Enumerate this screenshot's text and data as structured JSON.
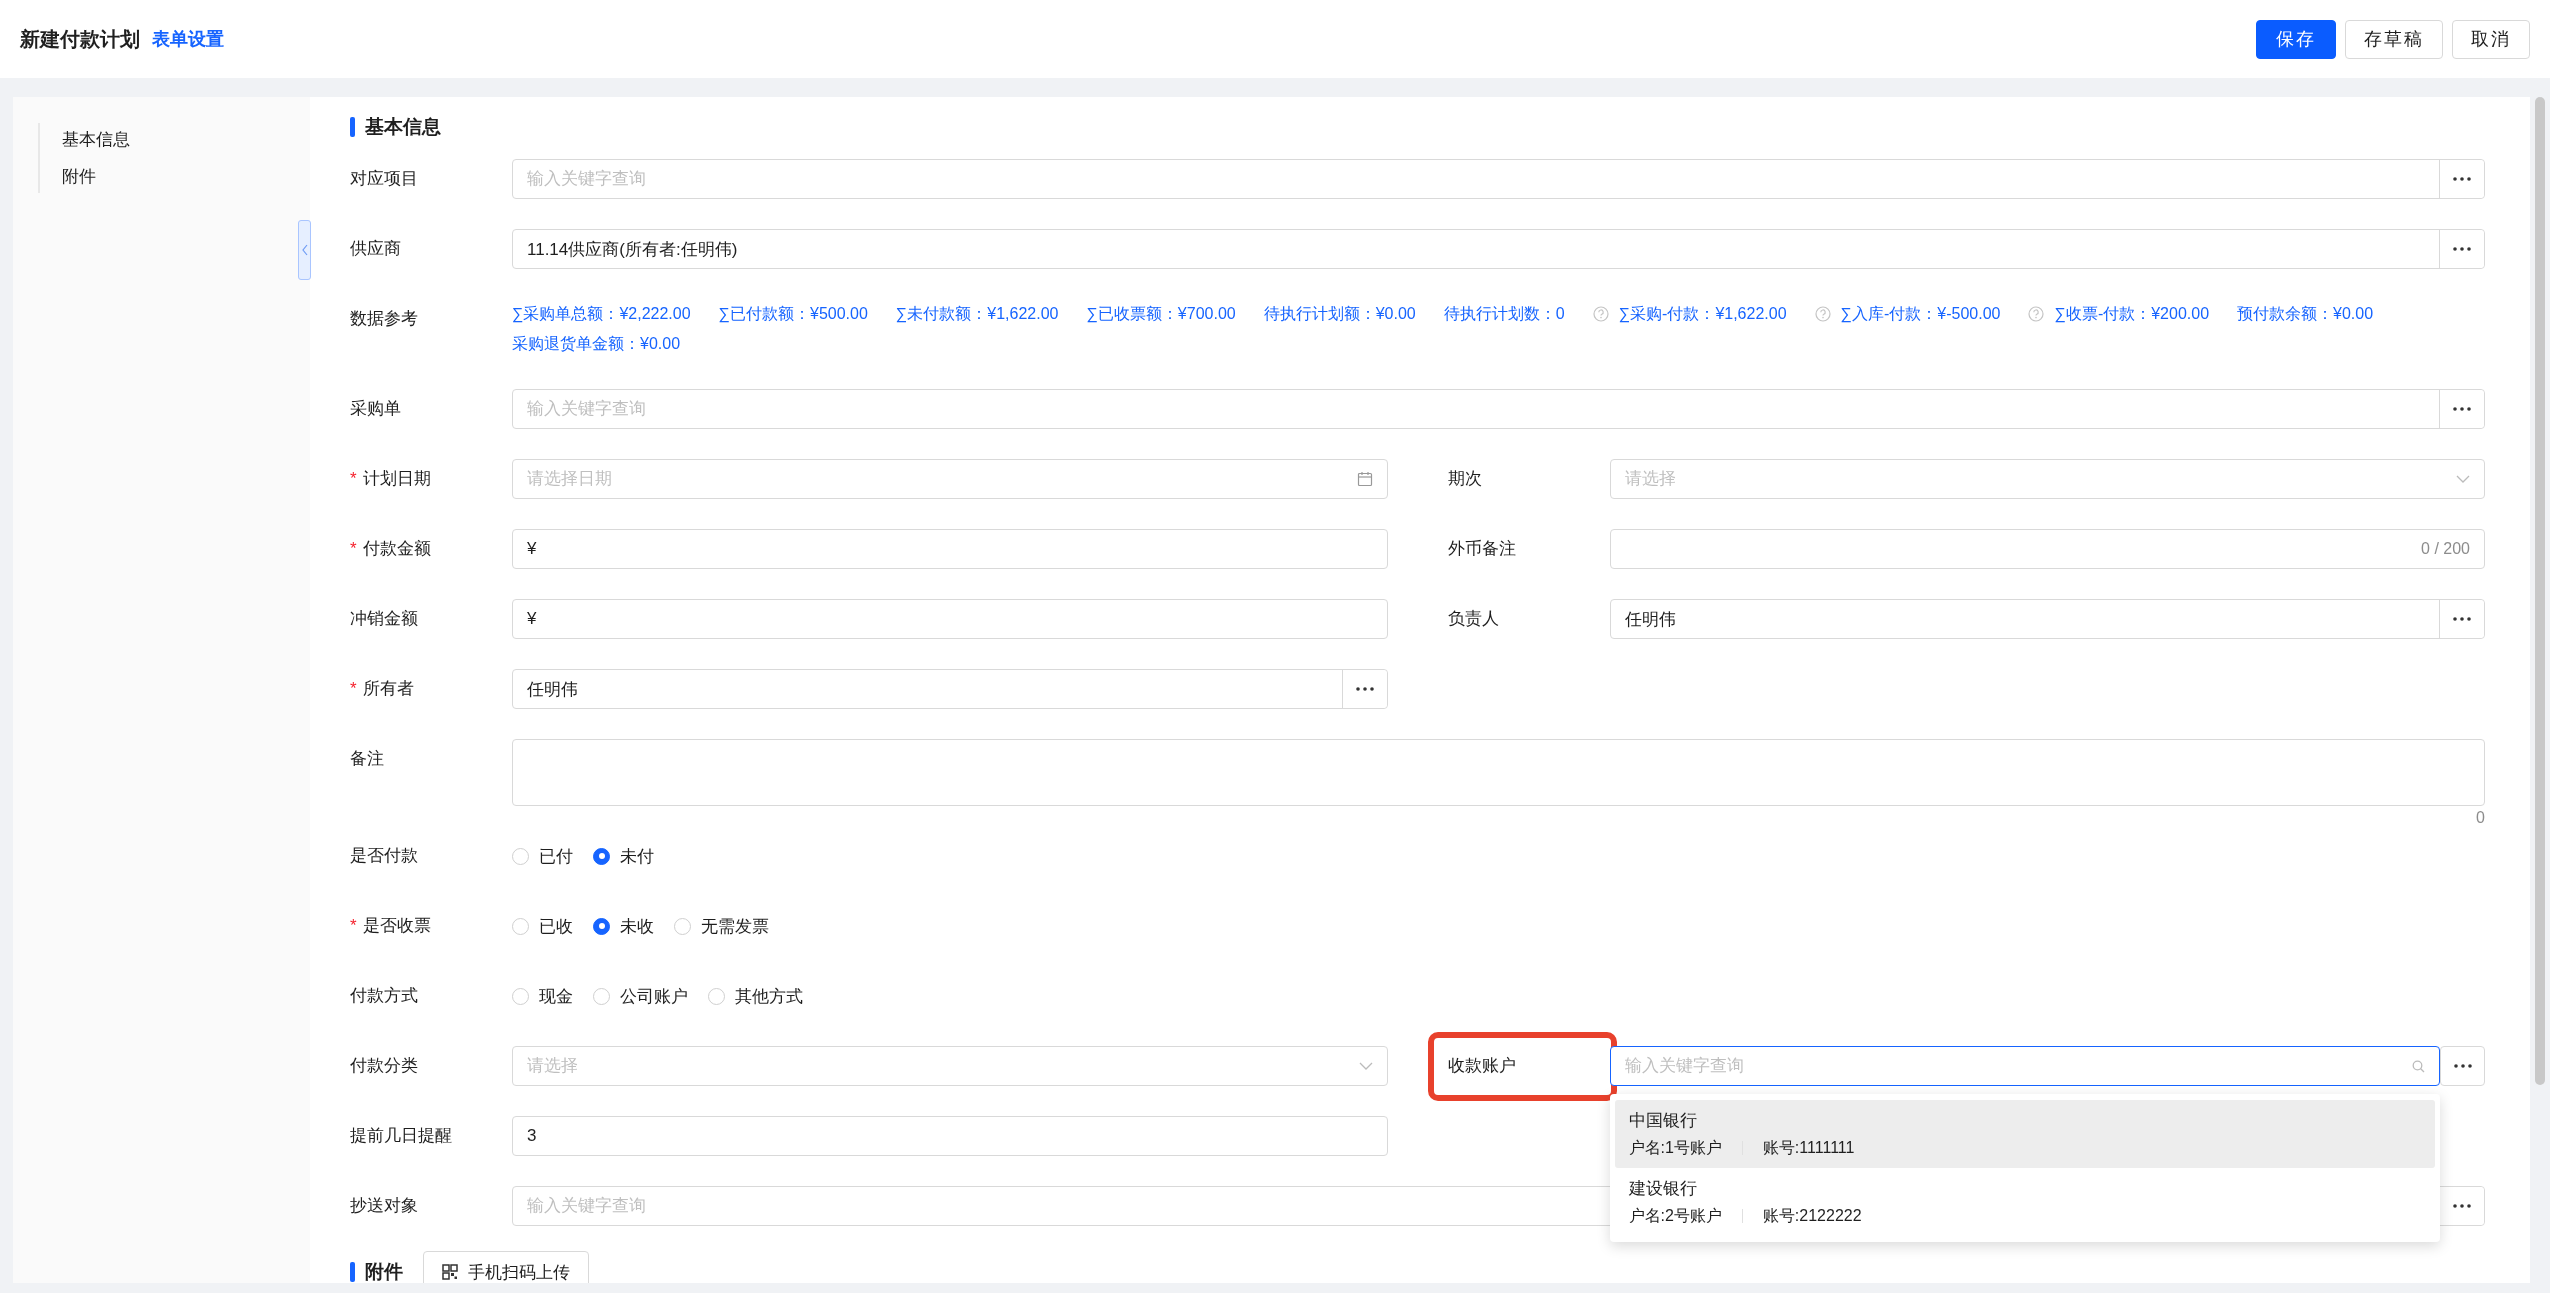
{
  "header": {
    "title": "新建付款计划",
    "link": "表单设置",
    "buttons": [
      {
        "label": "保存",
        "kind": "primary"
      },
      {
        "label": "存草稿",
        "kind": "default"
      },
      {
        "label": "取消",
        "kind": "default"
      }
    ]
  },
  "sidebar": {
    "items": [
      {
        "label": "基本信息"
      },
      {
        "label": "附件"
      }
    ]
  },
  "basic_info": {
    "title": "基本信息",
    "rows": [
      {
        "cells": [
          {
            "label": "对应项目",
            "kind": "lookup",
            "placeholder": "输入关键字查询"
          }
        ]
      },
      {
        "cells": [
          {
            "label": "供应商",
            "kind": "lookup",
            "value": "11.14供应商(所有者:任明伟)"
          }
        ]
      },
      {
        "cells": [
          {
            "label": "数据参考",
            "kind": "reference",
            "items": [
              {
                "text": "∑采购单总额：¥2,222.00",
                "help": false
              },
              {
                "text": "∑已付款额：¥500.00",
                "help": false
              },
              {
                "text": "∑未付款额：¥1,622.00",
                "help": false
              },
              {
                "text": "∑已收票额：¥700.00",
                "help": false
              },
              {
                "text": "待执行计划额：¥0.00",
                "help": false
              },
              {
                "text": "待执行计划数：0",
                "help": false
              },
              {
                "text": "∑采购-付款：¥1,622.00",
                "help": true
              },
              {
                "text": "∑入库-付款：¥-500.00",
                "help": true
              },
              {
                "text": "∑收票-付款：¥200.00",
                "help": true
              },
              {
                "text": "预付款余额：¥0.00",
                "help": false
              },
              {
                "text": "采购退货单金额：¥0.00",
                "help": false
              }
            ]
          }
        ]
      },
      {
        "cells": [
          {
            "label": "采购单",
            "kind": "lookup",
            "placeholder": "输入关键字查询"
          }
        ]
      },
      {
        "cells": [
          {
            "label": "计划日期",
            "mark": "*",
            "kind": "date",
            "placeholder": "请选择日期"
          },
          {
            "label": "期次",
            "kind": "select",
            "placeholder": "请选择"
          }
        ]
      },
      {
        "cells": [
          {
            "label": "付款金额",
            "mark": "*",
            "kind": "text",
            "value": "¥"
          },
          {
            "label": "外币备注",
            "kind": "counter",
            "count": "0 / 200"
          }
        ]
      },
      {
        "cells": [
          {
            "label": "冲销金额",
            "kind": "text",
            "value": "¥"
          },
          {
            "label": "负责人",
            "kind": "lookup",
            "value": "任明伟"
          }
        ]
      },
      {
        "cells": [
          {
            "label": "所有者",
            "mark": "*",
            "kind": "lookup",
            "value": "任明伟",
            "half": true
          }
        ]
      },
      {
        "cells": [
          {
            "label": "备注",
            "kind": "textarea",
            "count": "0"
          }
        ]
      },
      {
        "cells": [
          {
            "label": "是否付款",
            "kind": "radio",
            "options": [
              {
                "label": "已付",
                "selected": false
              },
              {
                "label": "未付",
                "selected": true
              }
            ]
          }
        ]
      },
      {
        "cells": [
          {
            "label": "是否收票",
            "mark": "*",
            "kind": "radio",
            "options": [
              {
                "label": "已收",
                "selected": false
              },
              {
                "label": "未收",
                "selected": true
              },
              {
                "label": "无需发票",
                "selected": false
              }
            ]
          }
        ]
      },
      {
        "cells": [
          {
            "label": "付款方式",
            "kind": "radio",
            "options": [
              {
                "label": "现金",
                "selected": false
              },
              {
                "label": "公司账户",
                "selected": false
              },
              {
                "label": "其他方式",
                "selected": false
              }
            ]
          }
        ]
      },
      {
        "cells": [
          {
            "label": "付款分类",
            "kind": "select",
            "placeholder": "请选择"
          },
          {
            "label": "收款账户",
            "kind": "search",
            "placeholder": "输入关键字查询",
            "focused": true,
            "highlighted": true,
            "options": [
              {
                "bank": "中国银行",
                "holder": "户名:1号账户",
                "account": "账号:1111111",
                "active": true
              },
              {
                "bank": "建设银行",
                "holder": "户名:2号账户",
                "account": "账号:2122222",
                "active": false
              }
            ]
          }
        ]
      },
      {
        "cells": [
          {
            "label": "提前几日提醒",
            "kind": "text",
            "value": "3",
            "half": true
          }
        ]
      },
      {
        "cells": [
          {
            "label": "抄送对象",
            "kind": "lookup",
            "placeholder": "输入关键字查询"
          }
        ]
      }
    ]
  },
  "attachments": {
    "title": "附件",
    "upload_button": "手机扫码上传"
  }
}
